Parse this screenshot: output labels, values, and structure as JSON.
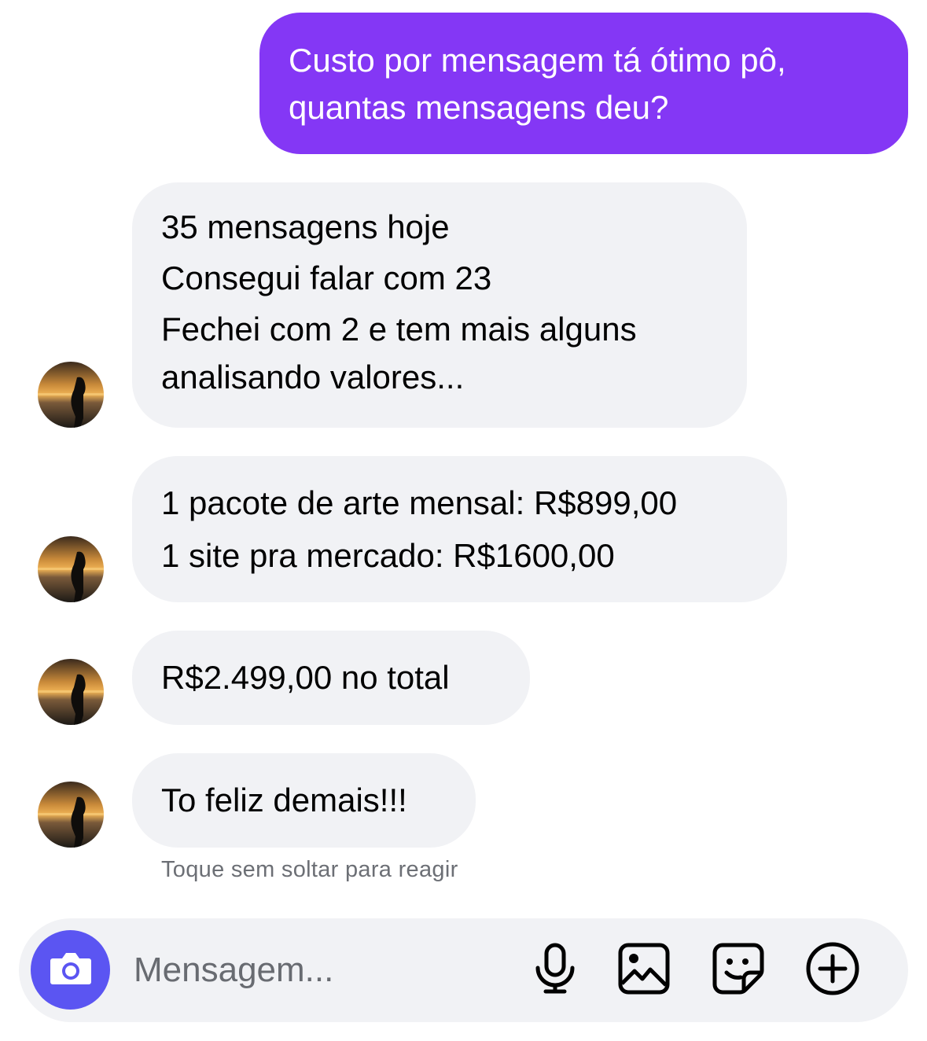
{
  "conversation": {
    "outgoing": {
      "lines": [
        "Custo por mensagem tá ótimo pô,",
        "quantas mensagens deu?"
      ]
    },
    "incoming": [
      {
        "lines": [
          "35 mensagens hoje",
          "Consegui falar com 23",
          "Fechei com 2 e tem mais alguns",
          "analisando valores..."
        ]
      },
      {
        "lines": [
          "1 pacote de arte mensal: R$899,00",
          "1 site pra mercado: R$1600,00"
        ]
      },
      {
        "lines": [
          "R$2.499,00 no total"
        ]
      },
      {
        "lines": [
          "To feliz demais!!!"
        ]
      }
    ],
    "reaction_hint": "Toque sem soltar para reagir"
  },
  "composer": {
    "placeholder": "Mensagem...",
    "icons": [
      "camera-icon",
      "microphone-icon",
      "image-icon",
      "sticker-icon",
      "plus-icon"
    ]
  },
  "colors": {
    "outgoing_bubble": "#8437f5",
    "incoming_bubble": "#f1f2f5",
    "camera_button": "#5b55f2",
    "composer_bg": "#f1f2f5"
  }
}
